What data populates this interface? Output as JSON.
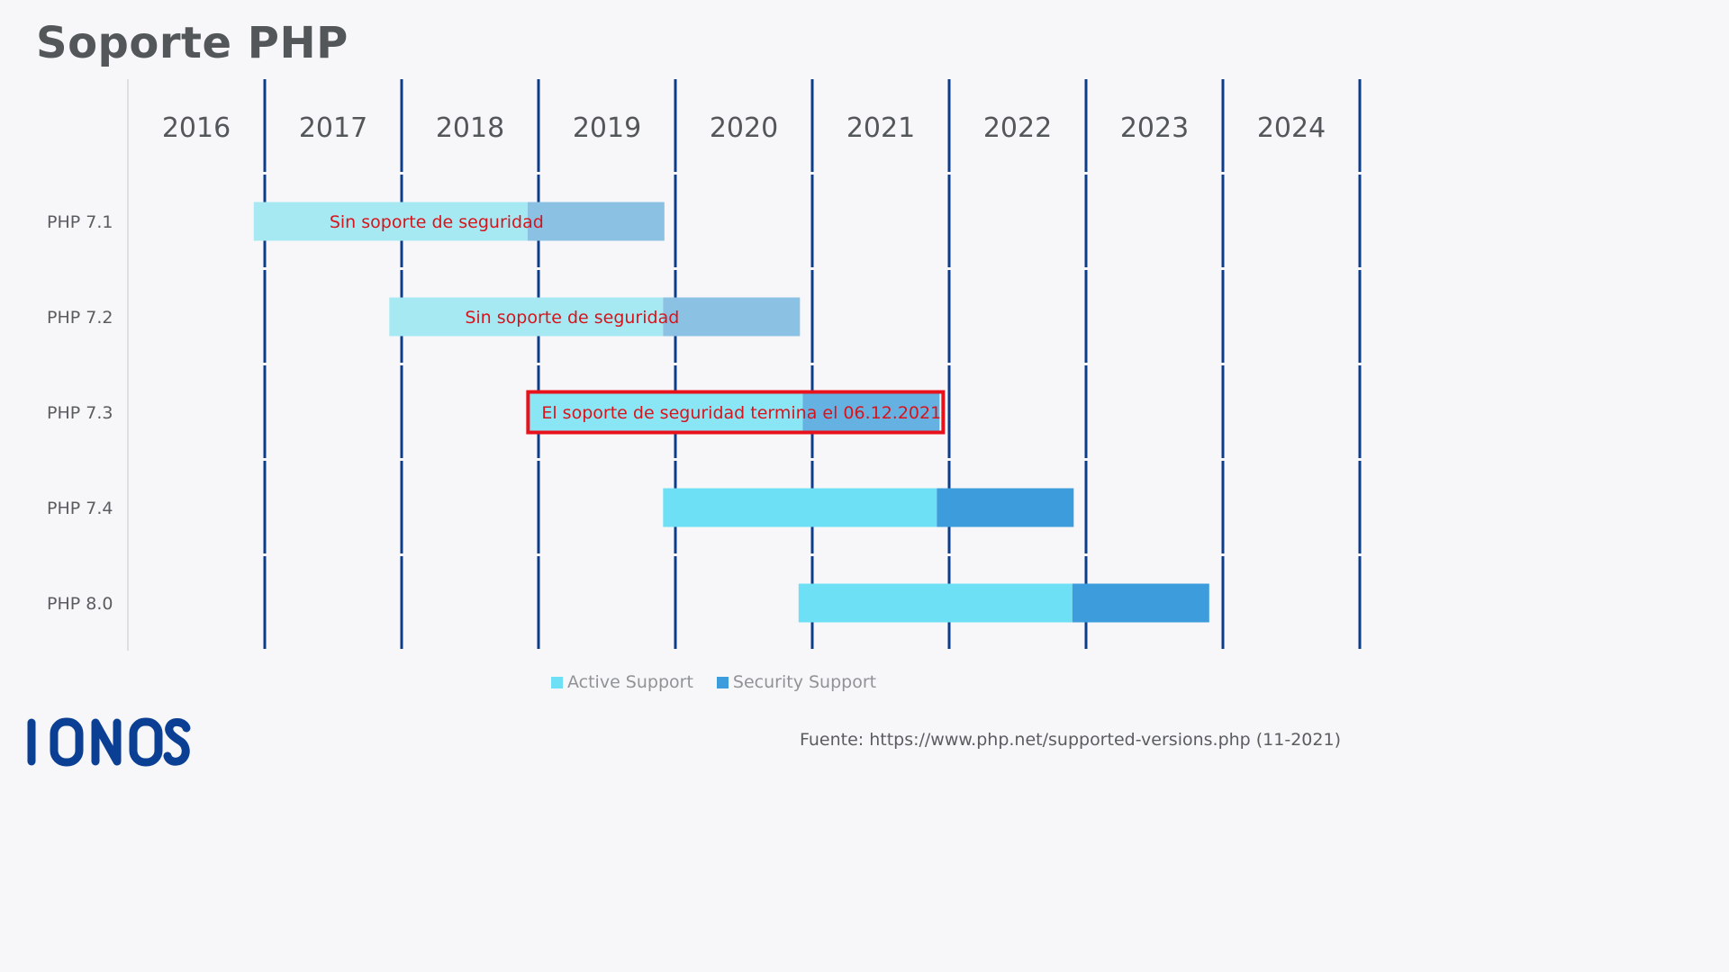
{
  "title": "Soporte PHP",
  "chart_data": {
    "type": "gantt",
    "title": "Soporte PHP",
    "xlabel": "",
    "ylabel": "",
    "x_range": [
      2016,
      2025
    ],
    "x_ticks": [
      "2016",
      "2017",
      "2018",
      "2019",
      "2020",
      "2021",
      "2022",
      "2023",
      "2024"
    ],
    "grid": true,
    "legend_position": "bottom-center",
    "colors": {
      "active": "#6ee0f5",
      "security": "#3d9ddc",
      "active_expired": "#a6e9f3",
      "security_expired": "#8bc2e4",
      "active_highlight": "#8ae5f5",
      "security_highlight": "#65b1e1",
      "gridline": "#0d3d8a",
      "highlight_border": "#e8121c",
      "annotation_text": "#d7141c"
    },
    "series": [
      {
        "name": "Active Support",
        "key": "active"
      },
      {
        "name": "Security Support",
        "key": "security"
      }
    ],
    "rows": [
      {
        "label": "PHP 7.1",
        "release": 2016.92,
        "active_end": 2018.92,
        "security_end": 2019.92,
        "status": "expired",
        "annotation": "Sin soporte de seguridad",
        "highlight": false
      },
      {
        "label": "PHP 7.2",
        "release": 2017.91,
        "active_end": 2019.91,
        "security_end": 2020.91,
        "status": "expired",
        "annotation": "Sin soporte de seguridad",
        "highlight": false
      },
      {
        "label": "PHP 7.3",
        "release": 2018.93,
        "active_end": 2020.93,
        "security_end": 2021.93,
        "status": "ending",
        "annotation": "El soporte de seguridad termina el  06.12.2021",
        "highlight": true
      },
      {
        "label": "PHP 7.4",
        "release": 2019.91,
        "active_end": 2021.91,
        "security_end": 2022.91,
        "status": "supported",
        "annotation": "",
        "highlight": false
      },
      {
        "label": "PHP 8.0",
        "release": 2020.9,
        "active_end": 2022.9,
        "security_end": 2023.9,
        "status": "supported",
        "annotation": "",
        "highlight": false
      }
    ]
  },
  "legend": {
    "items": [
      {
        "label": "Active Support",
        "color": "#6ee0f5"
      },
      {
        "label": "Security Support",
        "color": "#3d9ddc"
      }
    ]
  },
  "footer": {
    "source": "Fuente: https://www.php.net/supported-versions.php (11-2021)",
    "logo_text": "IONOS",
    "logo_color": "#0b3f94"
  }
}
